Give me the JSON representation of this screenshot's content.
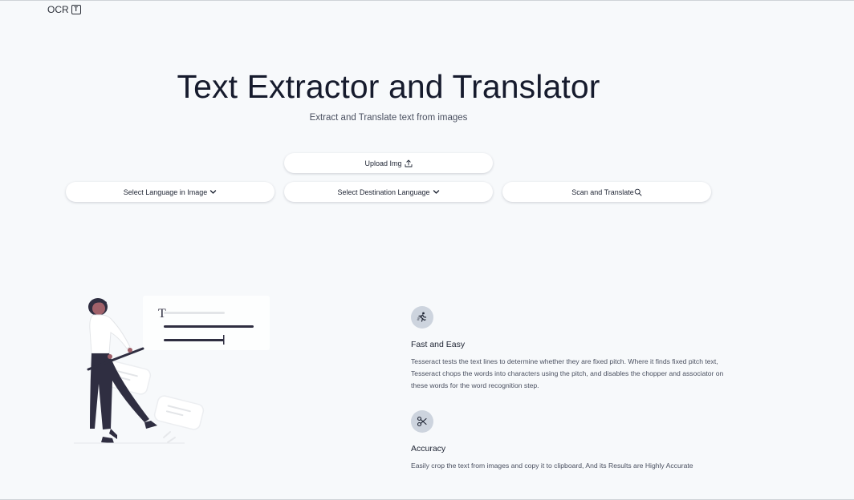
{
  "header": {
    "logo_text": "OCR",
    "logo_icon_glyph": "T"
  },
  "hero": {
    "title": "Text Extractor and Translator",
    "subtitle": "Extract and Translate text from images"
  },
  "controls": {
    "upload_label": "Upload Img",
    "source_language_label": "Select Language in Image",
    "destination_language_label": "Select Destination Language",
    "scan_label": "Scan and Translate"
  },
  "features": [
    {
      "icon": "running-person-icon",
      "title": "Fast and Easy",
      "description": "Tesseract tests the text lines to determine whether they are fixed pitch. Where it finds fixed pitch text, Tesseract chops the words into characters using the pitch, and disables the chopper and associator on these words for the word recognition step."
    },
    {
      "icon": "scissors-icon",
      "title": "Accuracy",
      "description": "Easily crop the text from images and copy it to clipboard, And its Results are Highly Accurate"
    }
  ],
  "colors": {
    "background": "#f7f9fb",
    "title": "#161b2d",
    "icon_circle": "#cdd4de",
    "illustration_dark": "#2f2e41"
  },
  "illustration": {
    "icon_glyph": "T"
  }
}
